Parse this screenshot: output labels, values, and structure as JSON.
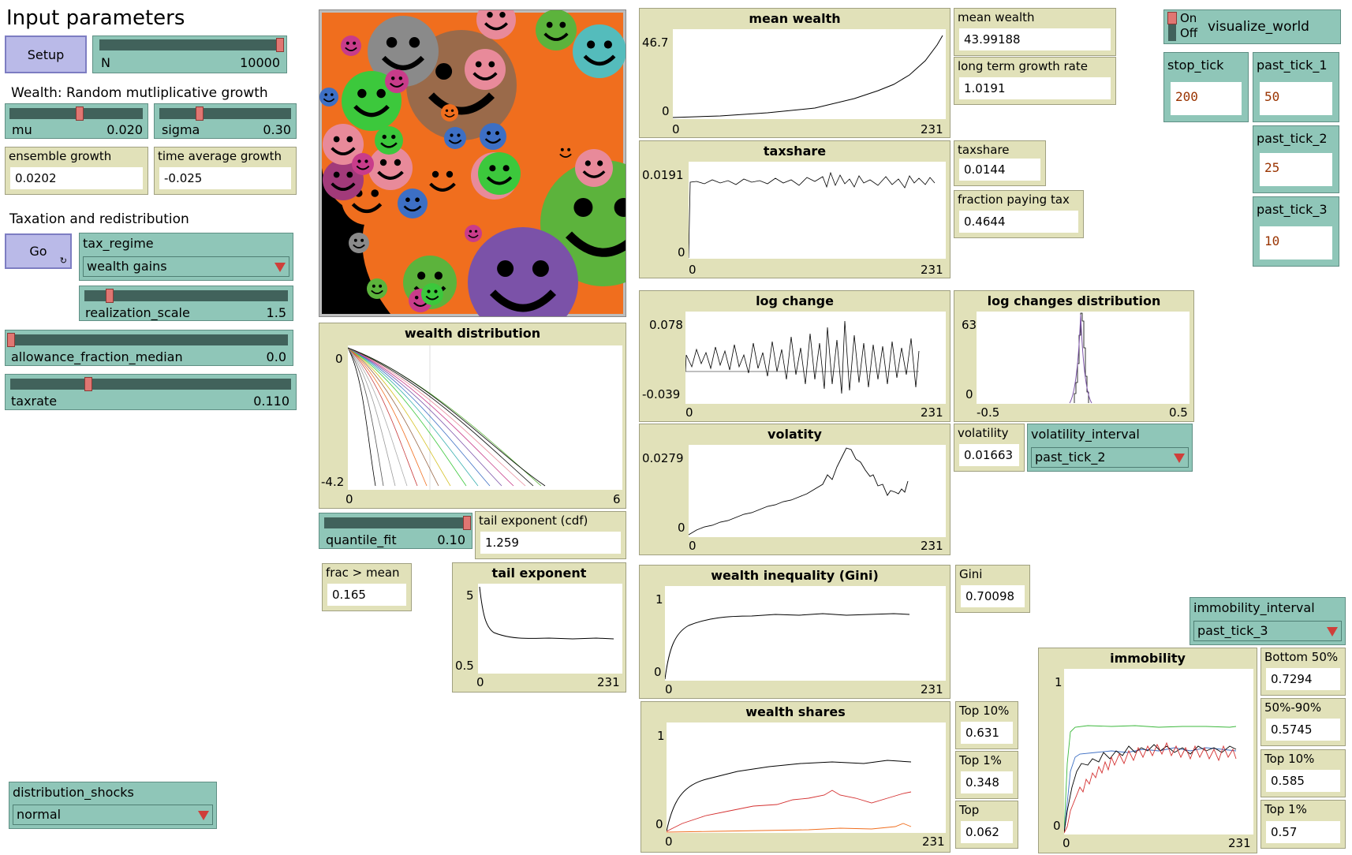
{
  "header": {
    "title": "Input parameters",
    "wealth_section": "Wealth: Random mutliplicative growth",
    "tax_section": "Taxation and redistribution"
  },
  "buttons": {
    "setup": "Setup",
    "go": "Go"
  },
  "sliders": {
    "N": {
      "name": "N",
      "value": "10000",
      "fraction": 1.0
    },
    "mu": {
      "name": "mu",
      "value": "0.020",
      "fraction": 0.52
    },
    "sigma": {
      "name": "sigma",
      "value": "0.30",
      "fraction": 0.3
    },
    "realization_scale": {
      "name": "realization_scale",
      "value": "1.5",
      "fraction": 0.12
    },
    "allowance_fraction_median": {
      "name": "allowance_fraction_median",
      "value": "0.0",
      "fraction": 0.0
    },
    "taxrate": {
      "name": "taxrate",
      "value": "0.110",
      "fraction": 0.28
    },
    "quantile_fit": {
      "name": "quantile_fit",
      "value": "0.10",
      "fraction": 1.0
    }
  },
  "choosers": {
    "tax_regime": {
      "label": "tax_regime",
      "value": "wealth gains"
    },
    "volatility_interval": {
      "label": "volatility_interval",
      "value": "past_tick_2"
    },
    "immobility_interval": {
      "label": "immobility_interval",
      "value": "past_tick_3"
    },
    "distribution_shocks": {
      "label": "distribution_shocks",
      "value": "normal"
    }
  },
  "monitors": {
    "ensemble_growth": {
      "label": "ensemble growth",
      "value": "0.0202"
    },
    "time_average_growth": {
      "label": "time average growth",
      "value": "-0.025"
    },
    "mean_wealth": {
      "label": "mean wealth",
      "value": "43.99188"
    },
    "long_term_growth_rate": {
      "label": "long term growth rate",
      "value": "1.0191"
    },
    "taxshare": {
      "label": "taxshare",
      "value": "0.0144"
    },
    "fraction_paying_tax": {
      "label": "fraction paying tax",
      "value": "0.4644"
    },
    "volatility": {
      "label": "volatility",
      "value": "0.01663"
    },
    "tail_exponent_cdf": {
      "label": "tail exponent (cdf)",
      "value": "1.259"
    },
    "frac_gt_mean": {
      "label": "frac > mean",
      "value": "0.165"
    },
    "gini": {
      "label": "Gini",
      "value": "0.70098"
    },
    "top10": {
      "label": "Top 10%",
      "value": "0.631"
    },
    "top1": {
      "label": "Top 1%",
      "value": "0.348"
    },
    "top": {
      "label": "Top",
      "value": "0.062"
    },
    "bottom50": {
      "label": "Bottom 50%",
      "value": "0.7294"
    },
    "mid": {
      "label": "50%-90%",
      "value": "0.5745"
    },
    "imm_top10": {
      "label": "Top 10%",
      "value": "0.585"
    },
    "imm_top1": {
      "label": "Top 1%",
      "value": "0.57"
    }
  },
  "switch": {
    "on": "On",
    "off": "Off",
    "name": "visualize_world"
  },
  "inputs": {
    "stop_tick": {
      "label": "stop_tick",
      "value": "200"
    },
    "past_tick_1": {
      "label": "past_tick_1",
      "value": "50"
    },
    "past_tick_2": {
      "label": "past_tick_2",
      "value": "25"
    },
    "past_tick_3": {
      "label": "past_tick_3",
      "value": "10"
    }
  },
  "plots": {
    "mean_wealth": {
      "title": "mean wealth",
      "ymax": "46.7",
      "ymin": "0",
      "xmin": "0",
      "xmax": "231"
    },
    "taxshare": {
      "title": "taxshare",
      "ymax": "0.0191",
      "ymin": "0",
      "xmin": "0",
      "xmax": "231"
    },
    "log_change": {
      "title": "log change",
      "ymax": "0.078",
      "ymin": "-0.039",
      "xmin": "0",
      "xmax": "231"
    },
    "log_changes_distribution": {
      "title": "log changes distribution",
      "ymax": "63",
      "ymin": "0",
      "xmin": "-0.5",
      "xmax": "0.5"
    },
    "volatility": {
      "title": "volatity",
      "ymax": "0.0279",
      "ymin": "0",
      "xmin": "0",
      "xmax": "231"
    },
    "wealth_distribution": {
      "title": "wealth distribution",
      "ymax": "0",
      "ymin": "-4.2",
      "xmin": "0",
      "xmax": "6"
    },
    "tail_exponent": {
      "title": "tail exponent",
      "ymax": "5",
      "ymin": "0.5",
      "xmin": "0",
      "xmax": "231"
    },
    "gini": {
      "title": "wealth inequality (Gini)",
      "ymax": "1",
      "ymin": "0",
      "xmin": "0",
      "xmax": "231"
    },
    "wealth_shares": {
      "title": "wealth shares",
      "ymax": "1",
      "ymin": "0",
      "xmin": "0",
      "xmax": "231"
    },
    "immobility": {
      "title": "immobility",
      "ymax": "1",
      "ymin": "0",
      "xmin": "0",
      "xmax": "231"
    }
  },
  "colors": {
    "world_bg": "#f06e1e",
    "button": "#babae8",
    "widget": "#8fc6b8",
    "monitor": "#e1e1b9"
  }
}
